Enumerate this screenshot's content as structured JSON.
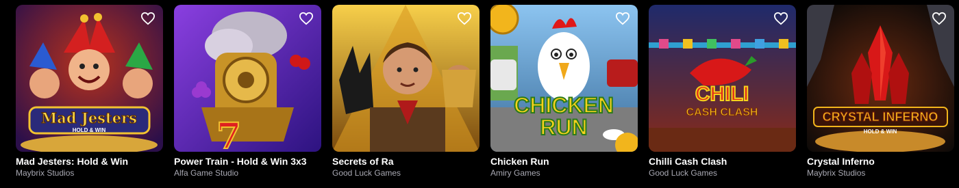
{
  "games": [
    {
      "title": "Mad Jesters: Hold & Win",
      "provider": "Maybrix Studios",
      "art_text": "Mad Jesters",
      "art_subtext": "HOLD & WIN",
      "colors": {
        "bg1": "#7a1410",
        "bg2": "#2b0f4a",
        "accent": "#f2c230"
      }
    },
    {
      "title": "Power Train - Hold & Win 3x3",
      "provider": "Alfa Game Studio",
      "art_text": "",
      "art_subtext": "",
      "colors": {
        "bg1": "#6b2fc9",
        "bg2": "#2d1380",
        "accent": "#d9a52c"
      }
    },
    {
      "title": "Secrets of Ra",
      "provider": "Good Luck Games",
      "art_text": "",
      "art_subtext": "",
      "colors": {
        "bg1": "#f3c23a",
        "bg2": "#7a4a0e",
        "accent": "#5a3a1e"
      }
    },
    {
      "title": "Chicken Run",
      "provider": "Amiry Games",
      "art_text": "CHICKEN",
      "art_subtext": "RUN",
      "colors": {
        "bg1": "#7fb6e6",
        "bg2": "#3b6e9c",
        "accent": "#f6c21c"
      }
    },
    {
      "title": "Chilli Cash Clash",
      "provider": "Good Luck Games",
      "art_text": "CHILI",
      "art_subtext": "CASH CLASH",
      "colors": {
        "bg1": "#1f2a6b",
        "bg2": "#8a2a18",
        "accent": "#f0b21e"
      }
    },
    {
      "title": "Crystal Inferno",
      "provider": "Maybrix Studios",
      "art_text": "CRYSTAL INFERNO",
      "art_subtext": "HOLD & WIN",
      "colors": {
        "bg1": "#3a1a0e",
        "bg2": "#0e0a08",
        "accent": "#e83a1a"
      }
    }
  ],
  "favorite_icon": "heart-outline-icon"
}
